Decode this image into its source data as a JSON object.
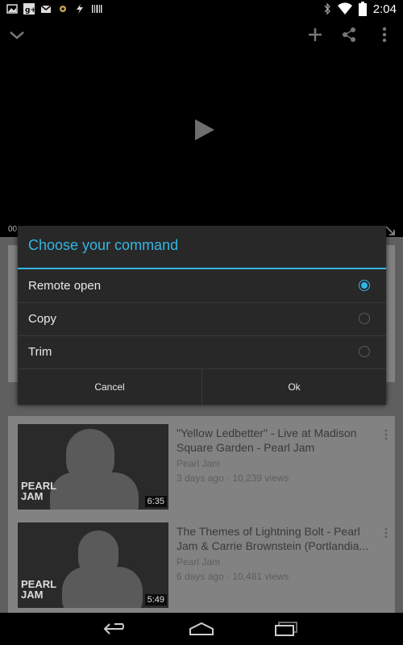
{
  "status_bar": {
    "time": "2:04",
    "left_icons": [
      "image-icon",
      "google-plus-icon",
      "gmail-icon",
      "settings-icon",
      "flash-icon",
      "barcode-icon"
    ],
    "right_icons": [
      "bluetooth-icon",
      "wifi-icon",
      "battery-icon"
    ]
  },
  "player": {
    "seek_time": "00"
  },
  "dialog": {
    "title": "Choose your command",
    "options": [
      {
        "label": "Remote open",
        "selected": true
      },
      {
        "label": "Copy",
        "selected": false
      },
      {
        "label": "Trim",
        "selected": false
      }
    ],
    "cancel_label": "Cancel",
    "ok_label": "Ok"
  },
  "videos": [
    {
      "title": "\"Yellow Ledbetter\" - Live at Madison Square Garden - Pearl Jam",
      "channel": "Pearl Jam",
      "meta": "3 days ago · 10,239 views",
      "duration": "6:35",
      "thumb_logo": "PEARL JAM"
    },
    {
      "title": "The Themes of Lightning Bolt - Pearl Jam & Carrie Brownstein (Portlandia...",
      "channel": "Pearl Jam",
      "meta": "6 days ago · 10,481 views",
      "duration": "5:49",
      "thumb_logo": "PEARL JAM"
    }
  ],
  "colors": {
    "accent": "#33b5e5",
    "dialog_bg": "#282828",
    "dim_content": "#828282"
  }
}
